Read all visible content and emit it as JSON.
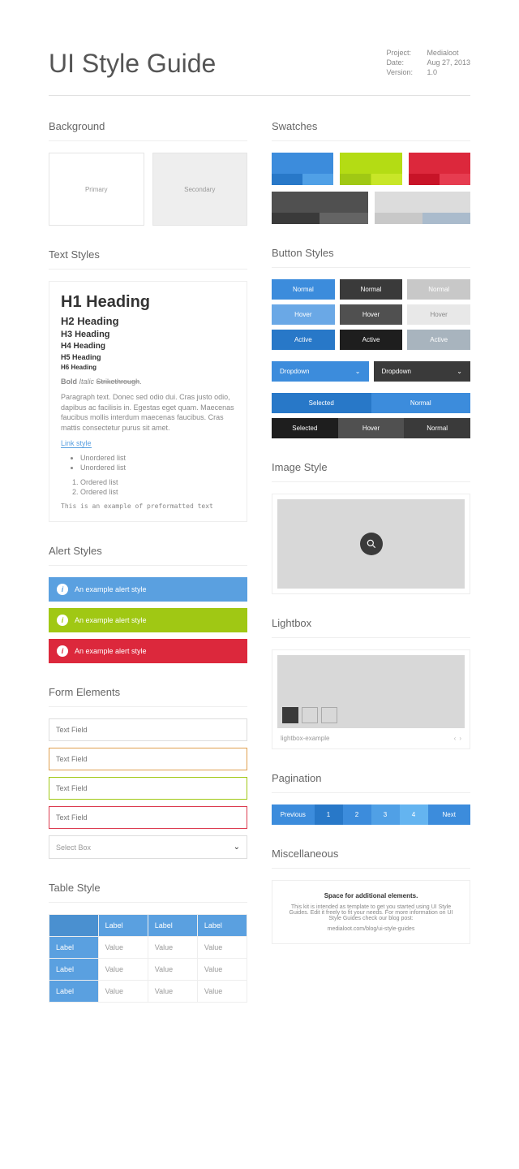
{
  "header": {
    "title": "UI Style Guide"
  },
  "meta": {
    "project_label": "Project:",
    "project_value": "Medialoot",
    "date_label": "Date:",
    "date_value": "Aug 27, 2013",
    "version_label": "Version:",
    "version_value": "1.0"
  },
  "sections": {
    "background": "Background",
    "swatches": "Swatches",
    "text_styles": "Text Styles",
    "button_styles": "Button Styles",
    "alert_styles": "Alert Styles",
    "image_style": "Image Style",
    "form_elements": "Form Elements",
    "lightbox": "Lightbox",
    "table_style": "Table Style",
    "pagination": "Pagination",
    "misc": "Miscellaneous"
  },
  "background": {
    "primary": "Primary",
    "secondary": "Secondary"
  },
  "text": {
    "h1": "H1 Heading",
    "h2": "H2 Heading",
    "h3": "H3 Heading",
    "h4": "H4 Heading",
    "h5": "H5 Heading",
    "h6": "H6 Heading",
    "bold": "Bold",
    "italic": "Italic",
    "strike": "Strikethrough",
    "para": "Paragraph text. Donec sed odio dui. Cras justo odio, dapibus ac facilisis in. Egestas eget quam. Maecenas faucibus mollis interdum maecenas faucibus. Cras mattis consectetur purus sit amet.",
    "link": "Link style",
    "ul1": "Unordered list",
    "ul2": "Unordered list",
    "ol1": "Ordered list",
    "ol2": "Ordered list",
    "pre": "This is an example of preformatted text"
  },
  "alerts": {
    "blue": "An example alert style",
    "green": "An example alert style",
    "red": "An example alert style"
  },
  "form": {
    "field1": "Text Field",
    "field2": "Text Field",
    "field3": "Text Field",
    "field4": "Text Field",
    "select": "Select Box"
  },
  "table": {
    "header": [
      "Label",
      "Label",
      "Label"
    ],
    "rows": [
      {
        "label": "Label",
        "cells": [
          "Value",
          "Value",
          "Value"
        ]
      },
      {
        "label": "Label",
        "cells": [
          "Value",
          "Value",
          "Value"
        ]
      },
      {
        "label": "Label",
        "cells": [
          "Value",
          "Value",
          "Value"
        ]
      }
    ]
  },
  "swatches": {
    "row1": [
      {
        "main": "#3c8cdc",
        "a": "#2878c8",
        "b": "#50a0e6"
      },
      {
        "main": "#b4dc14",
        "a": "#a0c814",
        "b": "#c8e628"
      },
      {
        "main": "#dc283c",
        "a": "#c81428",
        "b": "#e63c50"
      }
    ],
    "row2": [
      {
        "main": "#505050",
        "a": "#3a3a3a",
        "b": "#646464"
      },
      {
        "main": "#dcdcdc",
        "a": "#c8c8c8",
        "b": "#aabbcc"
      }
    ]
  },
  "buttons": {
    "rows": [
      {
        "label": "Normal",
        "c": [
          "#3c8cdc",
          "#3a3a3a",
          "#c8c8c8"
        ]
      },
      {
        "label": "Hover",
        "c": [
          "#6aa8e6",
          "#505050",
          "#e8e8e8"
        ]
      },
      {
        "label": "Active",
        "c": [
          "#2878c8",
          "#1e1e1e",
          "#a8b4be"
        ]
      }
    ],
    "hover_text": "#888",
    "dropdown": "Dropdown",
    "seg1": [
      {
        "label": "Selected",
        "bg": "#2878c8"
      },
      {
        "label": "Normal",
        "bg": "#3c8cdc"
      }
    ],
    "seg2": [
      {
        "label": "Selected",
        "bg": "#1e1e1e"
      },
      {
        "label": "Hover",
        "bg": "#505050"
      },
      {
        "label": "Normal",
        "bg": "#3a3a3a"
      }
    ]
  },
  "lightbox": {
    "caption": "lightbox-example"
  },
  "pagination": {
    "prev": "Previous",
    "next": "Next",
    "pages": [
      {
        "n": "1",
        "bg": "#2878c8"
      },
      {
        "n": "2",
        "bg": "#3c8cdc"
      },
      {
        "n": "3",
        "bg": "#50a0e6"
      },
      {
        "n": "4",
        "bg": "#64b4f0"
      }
    ]
  },
  "misc": {
    "title": "Space for additional elements.",
    "body": "This kit is intended as template to get you started using UI Style Guides. Edit it freely to fit your needs. For more information on UI Style Guides check our blog post:",
    "url": "medialoot.com/blog/ui-style-guides"
  }
}
